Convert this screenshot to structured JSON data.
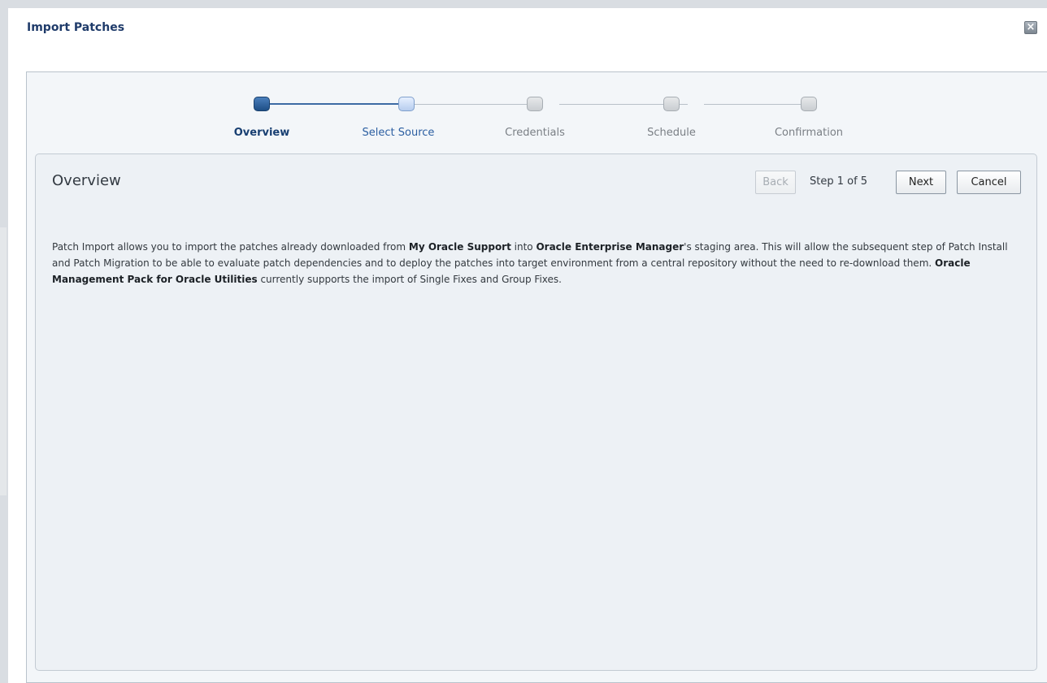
{
  "dialog": {
    "title": "Import Patches",
    "close_icon": "close-icon"
  },
  "train": {
    "steps": [
      {
        "label": "Overview",
        "state": "current"
      },
      {
        "label": "Select Source",
        "state": "next"
      },
      {
        "label": "Credentials",
        "state": "disabled"
      },
      {
        "label": "Schedule",
        "state": "disabled"
      },
      {
        "label": "Confirmation",
        "state": "disabled"
      }
    ]
  },
  "panel": {
    "title": "Overview",
    "back_label": "Back",
    "step_text": "Step 1 of 5",
    "next_label": "Next",
    "cancel_label": "Cancel"
  },
  "description": {
    "p1": "Patch Import allows you to import the patches already downloaded from ",
    "b1": "My Oracle Support",
    "p2": " into ",
    "b2": "Oracle Enterprise Manager",
    "p3": "'s staging area.  This will allow the subsequent step of Patch Install and Patch Migration to be able to evaluate patch dependencies and to deploy the patches into target environment from a central repository without the need to re-download them.  ",
    "b3": "Oracle Management Pack for Oracle Utilities",
    "p4": " currently supports the import of Single Fixes and Group Fixes."
  }
}
